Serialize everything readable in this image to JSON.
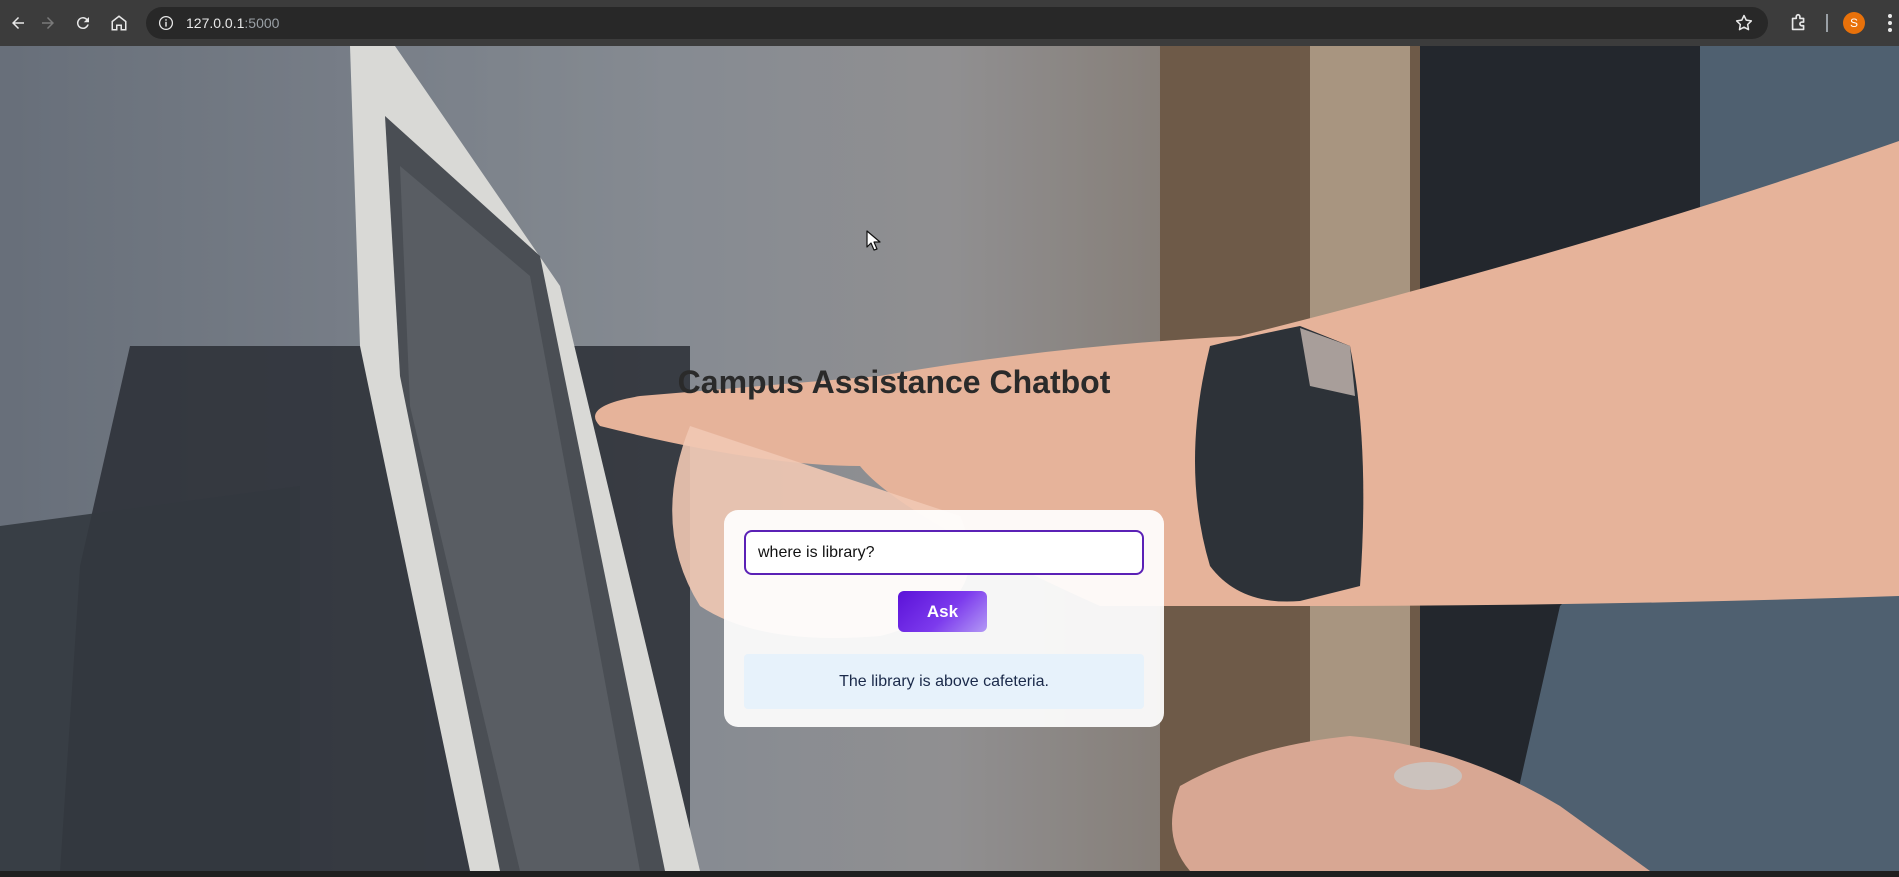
{
  "browser": {
    "url_host": "127.0.0.1",
    "url_port": ":5000",
    "profile_initial": "S",
    "icons": [
      "back-icon",
      "forward-icon",
      "reload-icon",
      "home-icon",
      "site-info-icon",
      "bookmark-star-icon",
      "extensions-icon",
      "menu-icon"
    ]
  },
  "page": {
    "title": "Campus Assistance Chatbot",
    "input_value": "where is library?",
    "ask_label": "Ask",
    "response_text": "The library is above cafeteria."
  },
  "colors": {
    "accent": "#5b21b6",
    "button_gradient_start": "#5b12d8",
    "button_gradient_end": "#b39af5",
    "response_bg": "#e4f1fc"
  }
}
